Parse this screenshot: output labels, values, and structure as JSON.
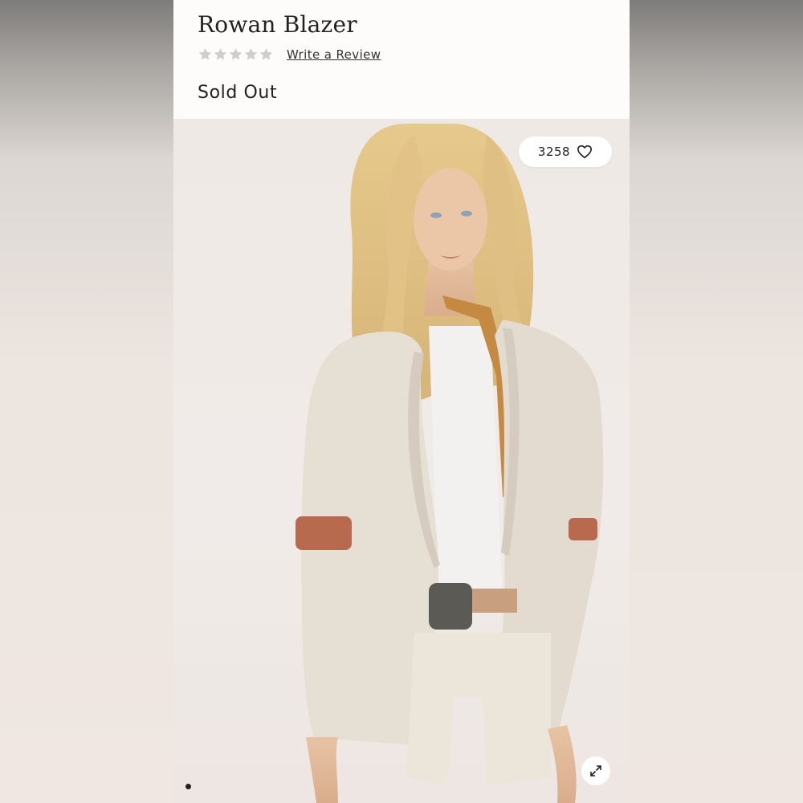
{
  "product": {
    "title": "Rowan Blazer",
    "rating": {
      "stars_filled": 0,
      "stars_total": 5,
      "review_link_label": "Write a Review"
    },
    "price_status": "Sold Out"
  },
  "gallery": {
    "likes_count": "3258",
    "current_slide": 1,
    "image_alt": "Model wearing Rowan Blazer",
    "icons": {
      "like": "heart-icon",
      "expand": "expand-icon"
    }
  },
  "colors": {
    "star_empty": "#cfcccb",
    "text": "#222222",
    "panel_bg": "#fdfcfb",
    "blazer": "#e6dfd3"
  }
}
